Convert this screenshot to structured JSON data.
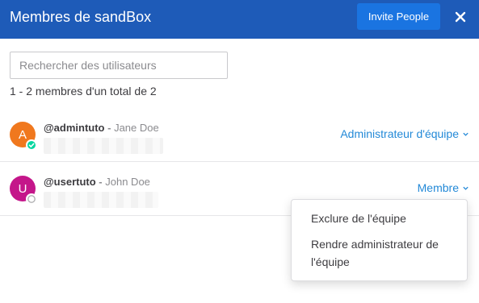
{
  "modal": {
    "title": "Membres de sandBox",
    "invite_label": "Invite People",
    "close_icon": "close-icon"
  },
  "search": {
    "placeholder": "Rechercher des utilisateurs",
    "value": ""
  },
  "members_count": "1 - 2 membres d'un total de 2",
  "members": [
    {
      "avatar_letter": "A",
      "avatar_color": "#f0781e",
      "username": "@admintuto",
      "separator": " - ",
      "full_name": "Jane Doe",
      "status": "online",
      "status_icon": "check-icon",
      "role": "Administrateur d'équipe"
    },
    {
      "avatar_letter": "U",
      "avatar_color": "#c4168a",
      "username": "@usertuto",
      "separator": " - ",
      "full_name": "John Doe",
      "status": "offline",
      "role": "Membre"
    }
  ],
  "role_menu": {
    "items": [
      "Exclure de l'équipe",
      "Rendre administrateur de l'équipe"
    ]
  },
  "colors": {
    "header_bg": "#1e5bb8",
    "button_bg": "#1a74e1",
    "link": "#2389d7",
    "online": "#06d6a0"
  }
}
